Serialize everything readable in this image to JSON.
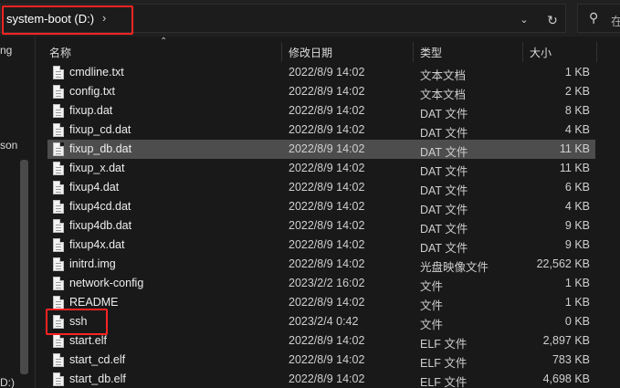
{
  "address": {
    "path": "system-boot (D:)",
    "chevron": "›"
  },
  "search": {
    "placeholder": "在"
  },
  "nav": {
    "items": [
      "ng",
      "son",
      "D:)"
    ]
  },
  "columns": {
    "name": "名称",
    "date": "修改日期",
    "type": "类型",
    "size": "大小"
  },
  "files": [
    {
      "name": "cmdline.txt",
      "date": "2022/8/9 14:02",
      "type": "文本文档",
      "size": "1 KB"
    },
    {
      "name": "config.txt",
      "date": "2022/8/9 14:02",
      "type": "文本文档",
      "size": "2 KB"
    },
    {
      "name": "fixup.dat",
      "date": "2022/8/9 14:02",
      "type": "DAT 文件",
      "size": "8 KB"
    },
    {
      "name": "fixup_cd.dat",
      "date": "2022/8/9 14:02",
      "type": "DAT 文件",
      "size": "4 KB"
    },
    {
      "name": "fixup_db.dat",
      "date": "2022/8/9 14:02",
      "type": "DAT 文件",
      "size": "11 KB",
      "selected": true
    },
    {
      "name": "fixup_x.dat",
      "date": "2022/8/9 14:02",
      "type": "DAT 文件",
      "size": "11 KB"
    },
    {
      "name": "fixup4.dat",
      "date": "2022/8/9 14:02",
      "type": "DAT 文件",
      "size": "6 KB"
    },
    {
      "name": "fixup4cd.dat",
      "date": "2022/8/9 14:02",
      "type": "DAT 文件",
      "size": "4 KB"
    },
    {
      "name": "fixup4db.dat",
      "date": "2022/8/9 14:02",
      "type": "DAT 文件",
      "size": "9 KB"
    },
    {
      "name": "fixup4x.dat",
      "date": "2022/8/9 14:02",
      "type": "DAT 文件",
      "size": "9 KB"
    },
    {
      "name": "initrd.img",
      "date": "2022/8/9 14:02",
      "type": "光盘映像文件",
      "size": "22,562 KB"
    },
    {
      "name": "network-config",
      "date": "2023/2/2 16:02",
      "type": "文件",
      "size": "1 KB"
    },
    {
      "name": "README",
      "date": "2022/8/9 14:02",
      "type": "文件",
      "size": "1 KB"
    },
    {
      "name": "ssh",
      "date": "2023/2/4 0:42",
      "type": "文件",
      "size": "0 KB"
    },
    {
      "name": "start.elf",
      "date": "2022/8/9 14:02",
      "type": "ELF 文件",
      "size": "2,897 KB"
    },
    {
      "name": "start_cd.elf",
      "date": "2022/8/9 14:02",
      "type": "ELF 文件",
      "size": "783 KB"
    },
    {
      "name": "start_db.elf",
      "date": "2022/8/9 14:02",
      "type": "ELF 文件",
      "size": "4,698 KB"
    }
  ]
}
